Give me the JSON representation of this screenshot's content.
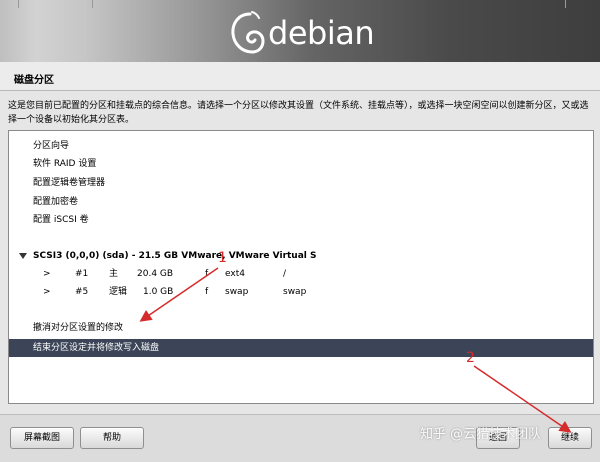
{
  "banner": {
    "logo_text": "debian"
  },
  "page": {
    "title": "磁盘分区"
  },
  "description": "这是您目前已配置的分区和挂载点的综合信息。请选择一个分区以修改其设置（文件系统、挂载点等），或选择一块空闲空间以创建新分区，又或选择一个设备以初始化其分区表。",
  "list": {
    "items": [
      "分区向导",
      "软件 RAID 设置",
      "配置逻辑卷管理器",
      "配置加密卷",
      "配置 iSCSI 卷"
    ],
    "disk": "SCSI3 (0,0,0) (sda) - 21.5 GB VMware, VMware Virtual S",
    "partitions": [
      {
        "arrow": ">",
        "num": "#1",
        "type": "主",
        "size": "20.4 GB",
        "flag": "f",
        "fs": "ext4",
        "mount": "/"
      },
      {
        "arrow": ">",
        "num": "#5",
        "type": "逻辑",
        "size": "1.0 GB",
        "flag": "f",
        "fs": "swap",
        "mount": "swap"
      }
    ],
    "undo": "撤消对分区设置的修改",
    "finish": "结束分区设定并将修改写入磁盘"
  },
  "buttons": {
    "screenshot": "屏幕截图",
    "help": "帮助",
    "back": "返回",
    "continue": "继续"
  },
  "watermark": "知乎 @云猎技术团队",
  "annotations": {
    "one": "1",
    "two": "2"
  },
  "colors": {
    "selection": "#3b4557",
    "annotation": "#d62b2b"
  }
}
